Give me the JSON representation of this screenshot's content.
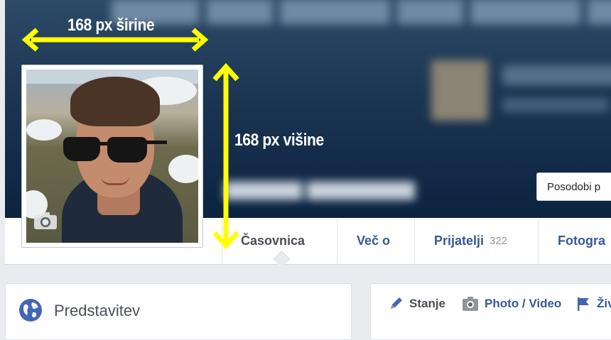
{
  "cover": {
    "update_button_label": "Posodobi p"
  },
  "annotations": {
    "width_label": "168 px širine",
    "height_label": "168 px višine",
    "arrow_color": "#ffff00"
  },
  "nav": {
    "tabs": [
      {
        "label": "Časovnica"
      },
      {
        "label": "Več o"
      },
      {
        "label": "Prijatelji",
        "count": "322"
      },
      {
        "label": "Fotogra"
      }
    ]
  },
  "intro": {
    "title": "Predstavitev"
  },
  "composer": {
    "items": [
      {
        "label": "Stanje",
        "icon": "pencil-icon"
      },
      {
        "label": "Photo / Video",
        "icon": "camera-icon"
      },
      {
        "label": "Živ",
        "icon": "flag-icon"
      }
    ]
  },
  "colors": {
    "link": "#365899",
    "accent": "#4267b2"
  }
}
